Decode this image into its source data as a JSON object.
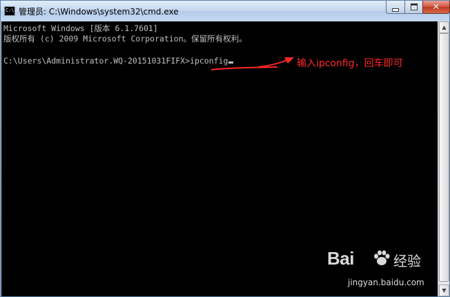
{
  "window": {
    "title": "管理员: C:\\Windows\\system32\\cmd.exe",
    "app_icon_text": "C:\\",
    "controls": {
      "minimize_icon": "minimize-icon",
      "maximize_icon": "maximize-icon",
      "close_icon": "close-icon",
      "close_glyph": "✕"
    }
  },
  "console": {
    "lines": [
      "Microsoft Windows [版本 6.1.7601]",
      "版权所有 (c) 2009 Microsoft Corporation。保留所有权利。",
      "",
      "C:\\Users\\Administrator.WQ-20151031FIFX>ipconfig"
    ],
    "background": "#000000",
    "text_color": "#c0c0c0"
  },
  "annotation": {
    "text": "输入ipconfig，回车即可",
    "color": "#ff2828"
  },
  "watermark": {
    "logo_text": "Bai",
    "logo_suffix": "经验",
    "url": "jingyan.baidu.com",
    "paw_icon": "baidu-paw-icon"
  },
  "scrollbar": {
    "up_glyph": "▲",
    "down_glyph": "▼"
  }
}
